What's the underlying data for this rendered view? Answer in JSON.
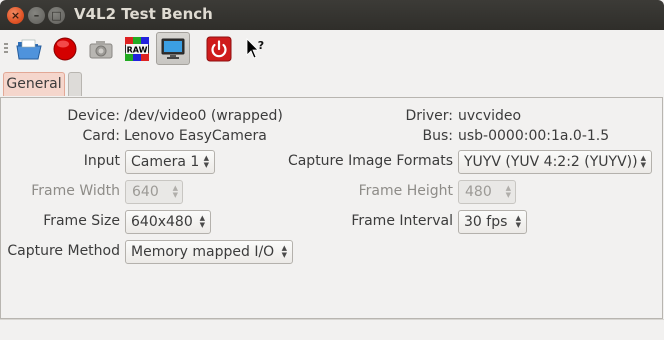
{
  "window": {
    "title": "V4L2 Test Bench"
  },
  "tabs": [
    "General"
  ],
  "info": {
    "device_label": "Device:",
    "device_value": "/dev/video0 (wrapped)",
    "card_label": "Card:",
    "card_value": "Lenovo EasyCamera",
    "driver_label": "Driver:",
    "driver_value": "uvcvideo",
    "bus_label": "Bus:",
    "bus_value": "usb-0000:00:1a.0-1.5"
  },
  "form": {
    "input_label": "Input",
    "input_value": "Camera 1",
    "formats_label": "Capture Image Formats",
    "formats_value": "YUYV (YUV 4:2:2 (YUYV))",
    "width_label": "Frame Width",
    "width_value": "640",
    "height_label": "Frame Height",
    "height_value": "480",
    "size_label": "Frame Size",
    "size_value": "640x480",
    "interval_label": "Frame Interval",
    "interval_value": "30 fps",
    "method_label": "Capture Method",
    "method_value": "Memory mapped I/O"
  },
  "icons": [
    "folder-open-icon",
    "record-icon",
    "camera-icon",
    "raw-icon",
    "display-icon",
    "power-icon",
    "whats-this-icon"
  ],
  "raw_icon_text": "RAW"
}
